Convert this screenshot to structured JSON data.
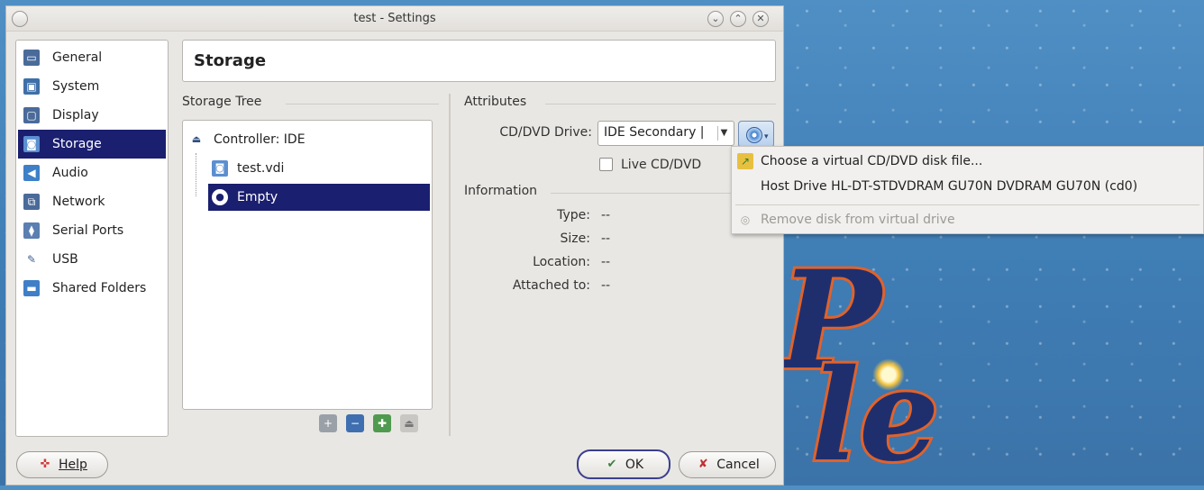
{
  "window": {
    "title": "test - Settings",
    "controls": [
      "minimize",
      "maximize",
      "close"
    ]
  },
  "sidebar": {
    "items": [
      {
        "label": "General",
        "icon": "monitor-icon"
      },
      {
        "label": "System",
        "icon": "chip-icon"
      },
      {
        "label": "Display",
        "icon": "display-icon"
      },
      {
        "label": "Storage",
        "icon": "disk-icon",
        "selected": true
      },
      {
        "label": "Audio",
        "icon": "speaker-icon"
      },
      {
        "label": "Network",
        "icon": "network-icon"
      },
      {
        "label": "Serial Ports",
        "icon": "serial-icon"
      },
      {
        "label": "USB",
        "icon": "usb-icon"
      },
      {
        "label": "Shared Folders",
        "icon": "folder-icon"
      }
    ]
  },
  "header": {
    "title": "Storage"
  },
  "storage_tree": {
    "label": "Storage Tree",
    "controller": "Controller: IDE",
    "items": [
      {
        "label": "test.vdi",
        "icon": "hard-disk-icon"
      },
      {
        "label": "Empty",
        "icon": "cd-icon",
        "selected": true
      }
    ]
  },
  "attributes": {
    "label": "Attributes",
    "cd_drive_label": "CD/DVD Drive:",
    "cd_drive_value": "IDE Secondary |",
    "live_cd_label": "Live CD/DVD",
    "live_cd_checked": false
  },
  "information": {
    "label": "Information",
    "rows": [
      {
        "key": "Type:",
        "value": "--"
      },
      {
        "key": "Size:",
        "value": "--"
      },
      {
        "key": "Location:",
        "value": "--"
      },
      {
        "key": "Attached to:",
        "value": "--"
      }
    ]
  },
  "buttons": {
    "help": "Help",
    "ok": "OK",
    "cancel": "Cancel"
  },
  "menu": {
    "items": [
      {
        "label": "Choose a virtual CD/DVD disk file...",
        "icon": "open-file-icon",
        "enabled": true
      },
      {
        "label": "Host Drive HL-DT-STDVDRAM GU70N DVDRAM GU70N (cd0)",
        "icon": "",
        "enabled": true
      },
      {
        "label": "Remove disk from virtual drive",
        "icon": "eject-icon",
        "enabled": false
      }
    ]
  },
  "colors": {
    "selection": "#1b1f6f",
    "desktop": "#4f8fc4"
  }
}
